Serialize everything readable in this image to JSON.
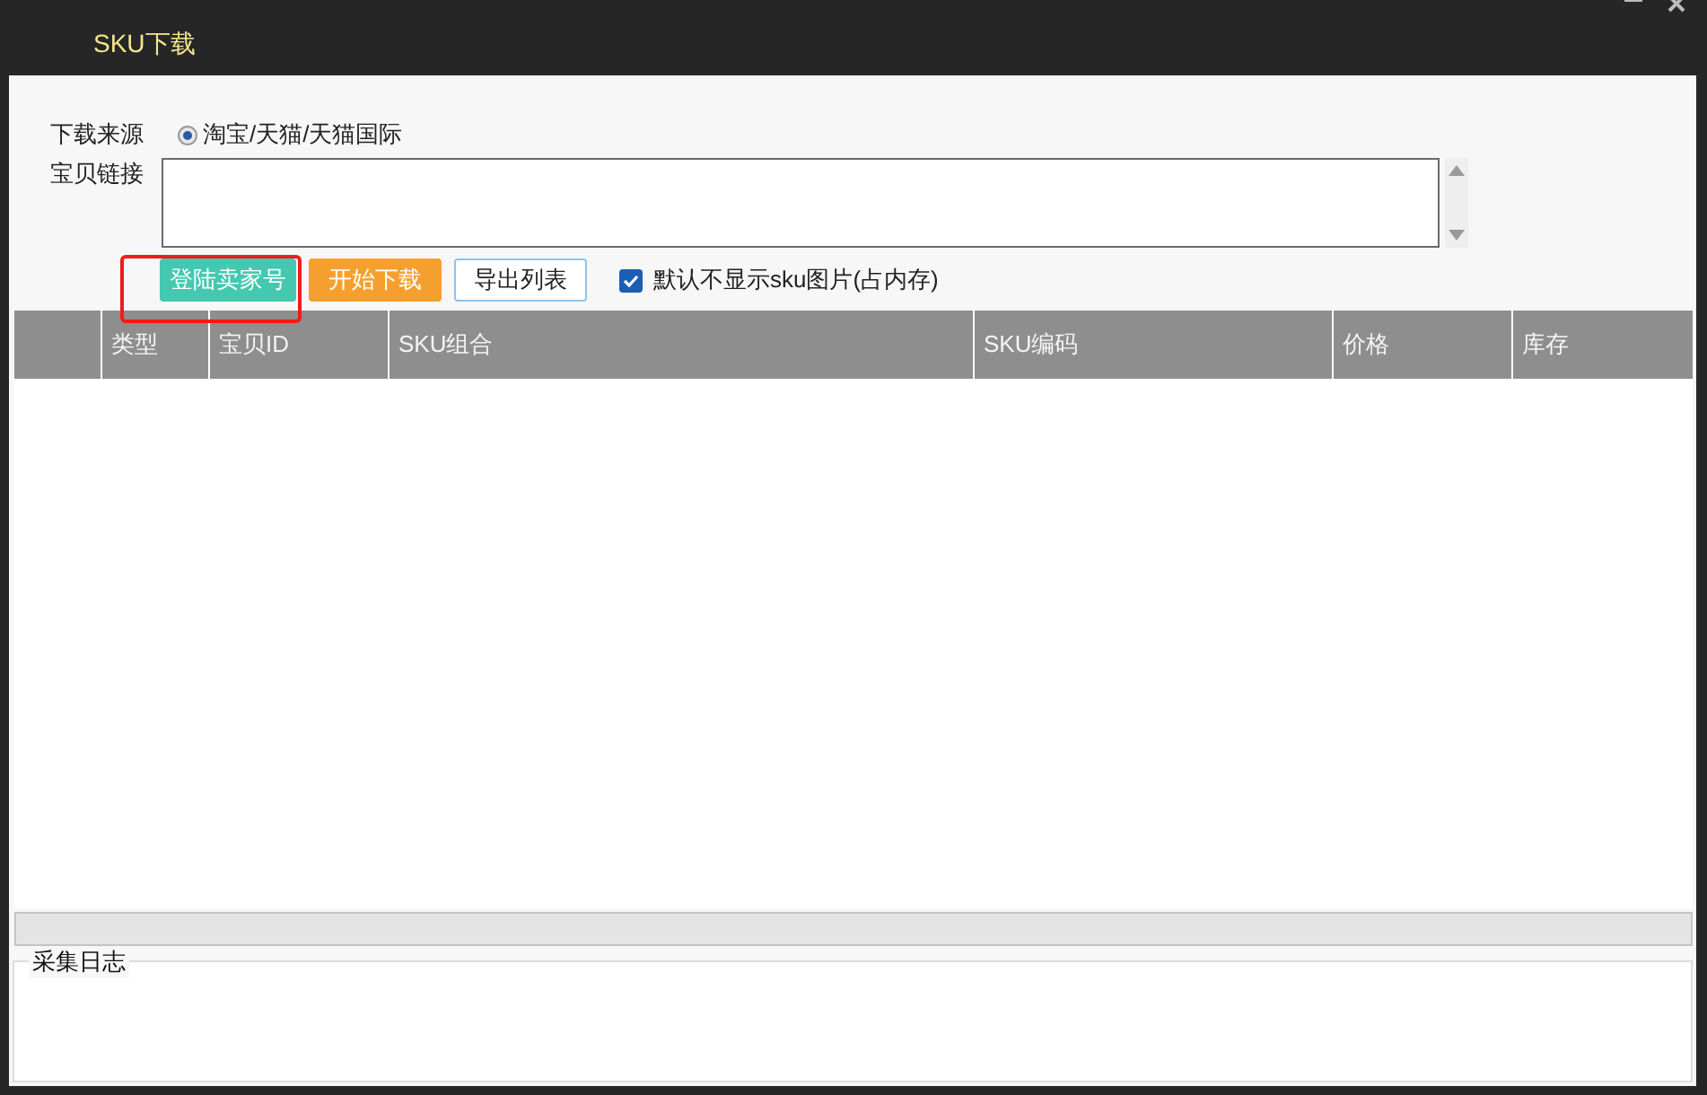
{
  "window": {
    "title": "SKU下载"
  },
  "source": {
    "label": "下载来源",
    "options": [
      {
        "label": "淘宝/天猫/天猫国际",
        "selected": true
      }
    ]
  },
  "link": {
    "label": "宝贝链接"
  },
  "buttons": [
    {
      "label": "登陆卖家号",
      "kind": "login",
      "highlighted": true
    },
    {
      "label": "开始下载",
      "kind": "start",
      "highlighted": false
    },
    {
      "label": "导出列表",
      "kind": "export",
      "highlighted": false
    }
  ],
  "hide_images": {
    "label": "默认不显示sku图片(占内存)",
    "checked": true
  },
  "table": {
    "columns": [
      "类型",
      "宝贝ID",
      "SKU组合",
      "SKU编码",
      "价格",
      "库存"
    ]
  },
  "log": {
    "title": "采集日志"
  }
}
